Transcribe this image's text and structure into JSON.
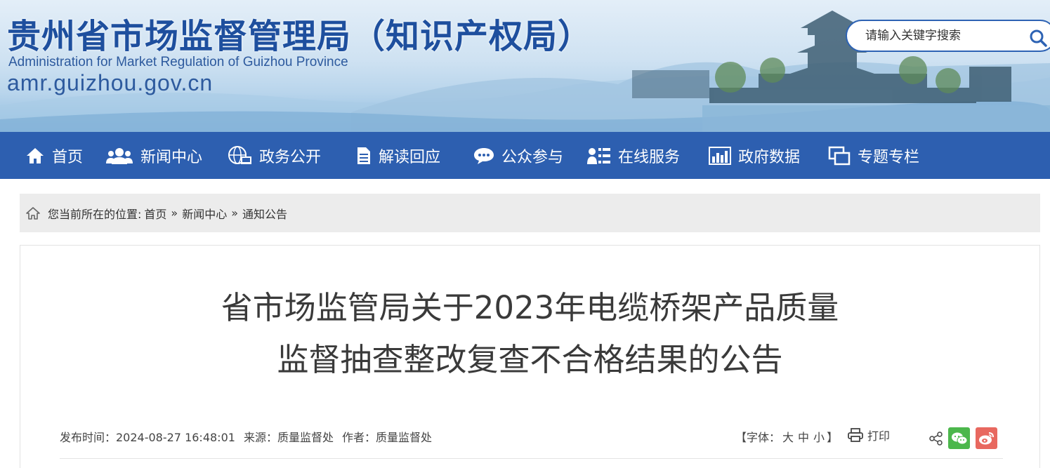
{
  "header": {
    "title": "贵州省市场监督管理局（知识产权局）",
    "subtitle": "Administration for Market Regulation of Guizhou Province",
    "domain": "amr.guizhou.gov.cn",
    "search_placeholder": "请输入关键字搜索",
    "search_icon": "search-icon"
  },
  "nav": {
    "items": [
      {
        "label": "首页",
        "icon": "home-icon"
      },
      {
        "label": "新闻中心",
        "icon": "people-icon"
      },
      {
        "label": "政务公开",
        "icon": "globe-icon"
      },
      {
        "label": "解读回应",
        "icon": "document-icon"
      },
      {
        "label": "公众参与",
        "icon": "chat-icon"
      },
      {
        "label": "在线服务",
        "icon": "user-list-icon"
      },
      {
        "label": "政府数据",
        "icon": "bar-chart-icon"
      },
      {
        "label": "专题专栏",
        "icon": "window-icon"
      }
    ]
  },
  "breadcrumb": {
    "prefix": "您当前所在的位置:",
    "items": [
      "首页",
      "新闻中心",
      "通知公告"
    ],
    "separator": "»"
  },
  "article": {
    "title_line1": "省市场监管局关于2023年电缆桥架产品质量",
    "title_line2": "监督抽查整改复查不合格结果的公告",
    "publish_time": "发布时间：2024-08-27 16:48:01",
    "source": "来源：质量监督处",
    "author": "作者：质量监督处",
    "font_size_label": "【字体：",
    "font_size_large": "大",
    "font_size_medium": "中",
    "font_size_small": "小",
    "font_size_close": "】",
    "print_label": "打印"
  },
  "colors": {
    "nav_bg": "#2d5fb0",
    "title_blue": "#1e4f9e",
    "wechat_green": "#4cb74c",
    "weibo_red": "#e8685f"
  }
}
